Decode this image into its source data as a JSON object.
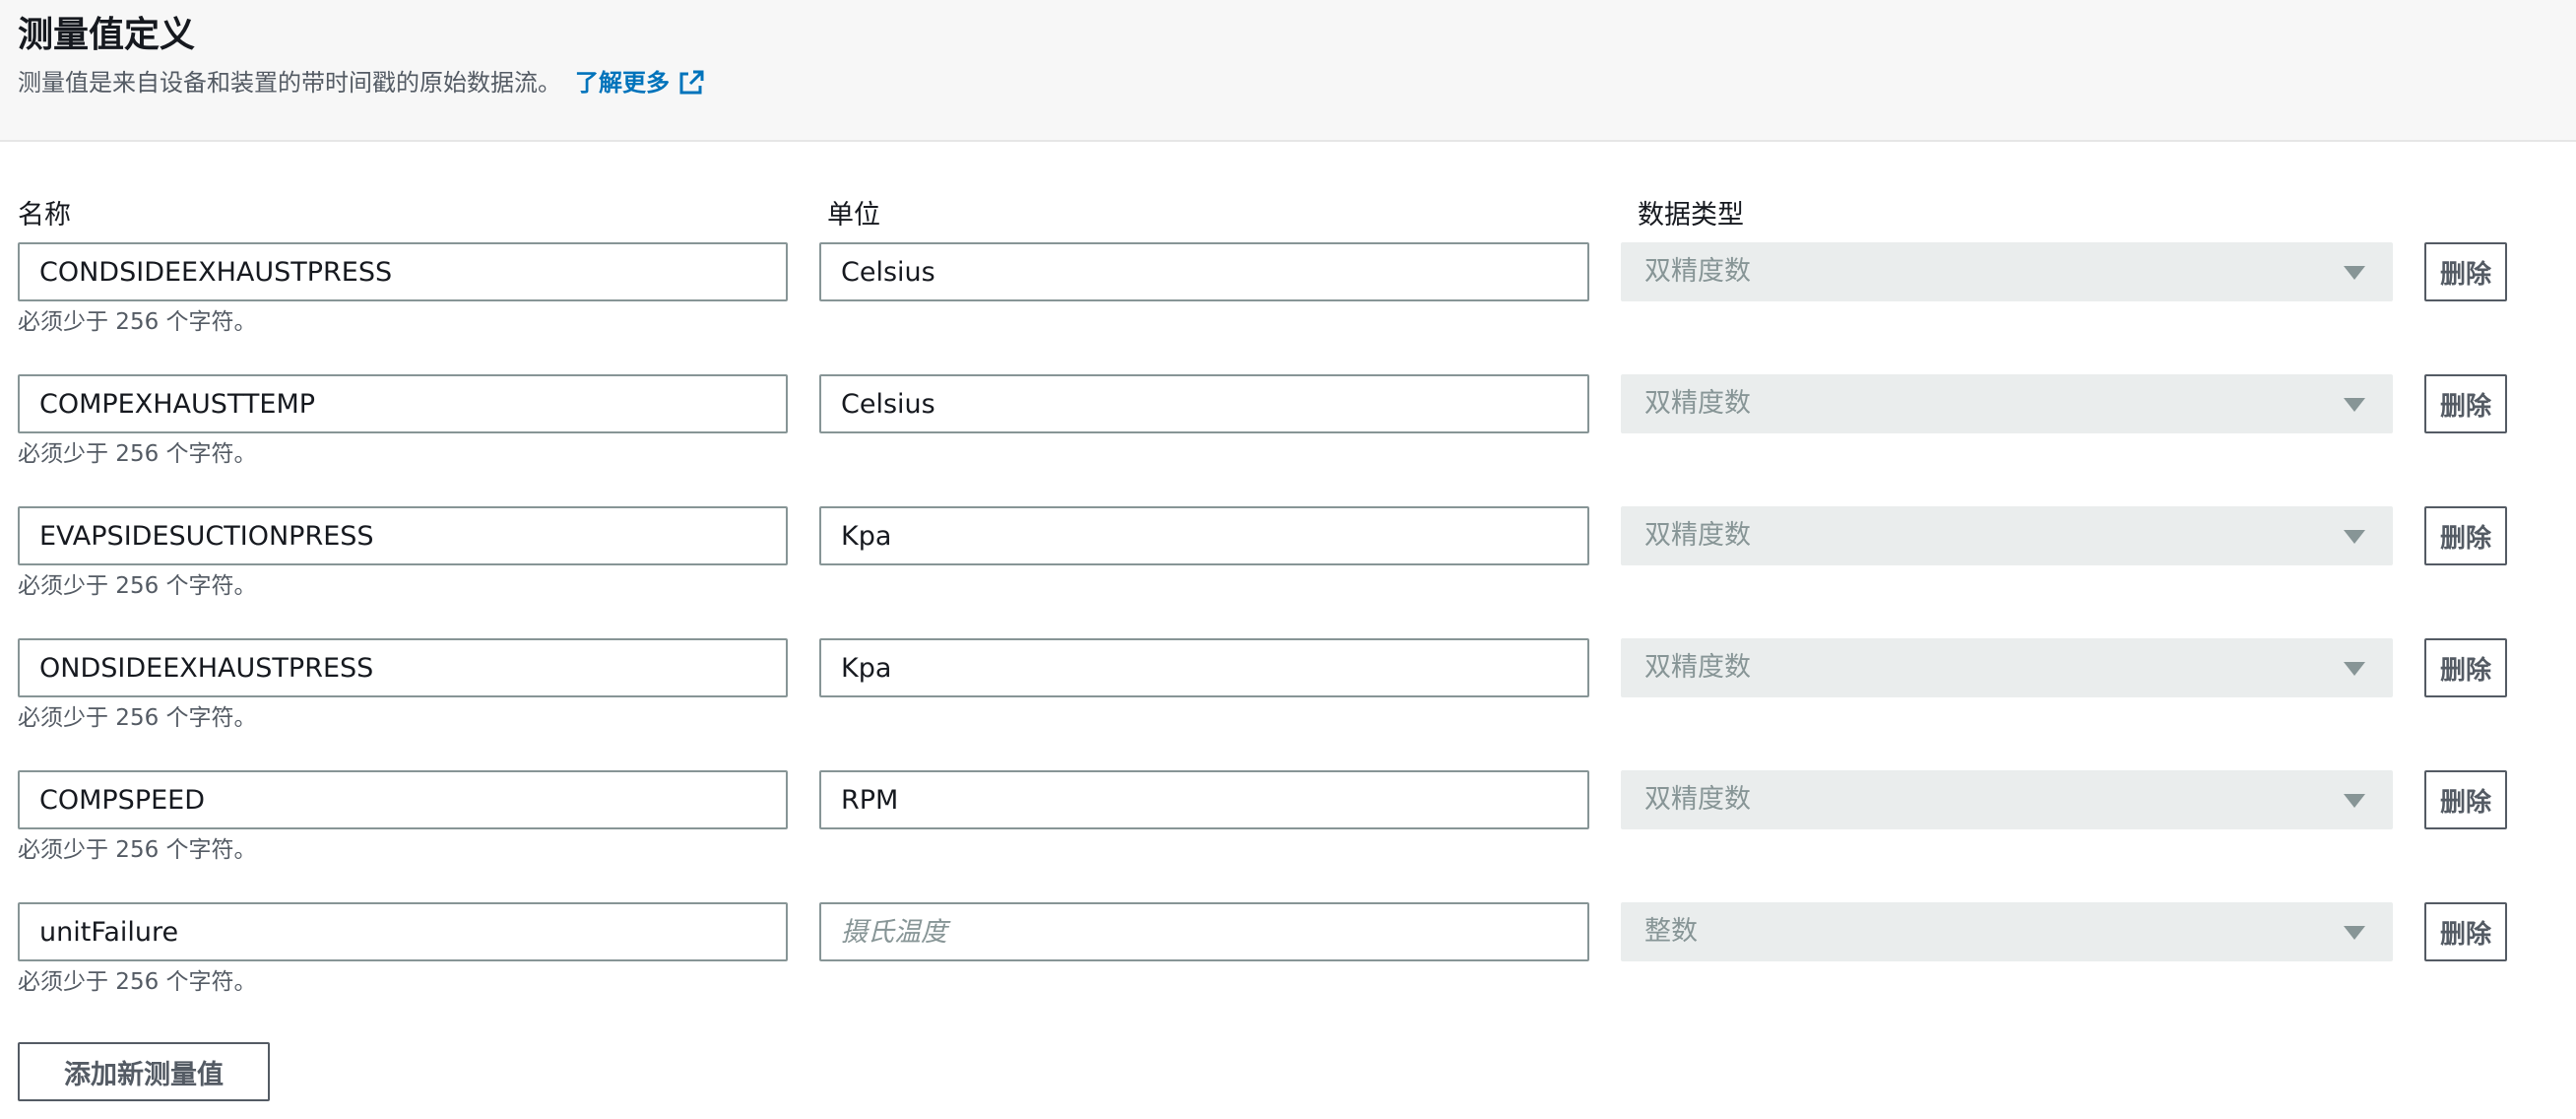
{
  "header": {
    "title": "测量值定义",
    "description": "测量值是来自设备和装置的带时间戳的原始数据流。",
    "learn_more_label": "了解更多"
  },
  "columns": {
    "name_label": "名称",
    "unit_label": "单位",
    "type_label": "数据类型"
  },
  "rows": [
    {
      "name": "CONDSIDEEXHAUSTPRESS",
      "unit": "Celsius",
      "unit_placeholder": "",
      "type": "双精度数",
      "constraint": "必须少于 256 个字符。",
      "delete_label": "删除"
    },
    {
      "name": "COMPEXHAUSTTEMP",
      "unit": "Celsius",
      "unit_placeholder": "",
      "type": "双精度数",
      "constraint": "必须少于 256 个字符。",
      "delete_label": "删除"
    },
    {
      "name": "EVAPSIDESUCTIONPRESS",
      "unit": "Kpa",
      "unit_placeholder": "",
      "type": "双精度数",
      "constraint": "必须少于 256 个字符。",
      "delete_label": "删除"
    },
    {
      "name": "ONDSIDEEXHAUSTPRESS",
      "unit": "Kpa",
      "unit_placeholder": "",
      "type": "双精度数",
      "constraint": "必须少于 256 个字符。",
      "delete_label": "删除"
    },
    {
      "name": "COMPSPEED",
      "unit": "RPM",
      "unit_placeholder": "",
      "type": "双精度数",
      "constraint": "必须少于 256 个字符。",
      "delete_label": "删除"
    },
    {
      "name": "unitFailure",
      "unit": "",
      "unit_placeholder": "摄氏温度",
      "type": "整数",
      "constraint": "必须少于 256 个字符。",
      "delete_label": "删除"
    }
  ],
  "add_button_label": "添加新测量值",
  "colors": {
    "link": "#0073bb",
    "header_bg": "#f7f7f7",
    "input_border": "#879596",
    "disabled_bg": "#eaeded"
  },
  "icons": {
    "learn_more": "external-link-icon",
    "select": "caret-down-icon"
  }
}
